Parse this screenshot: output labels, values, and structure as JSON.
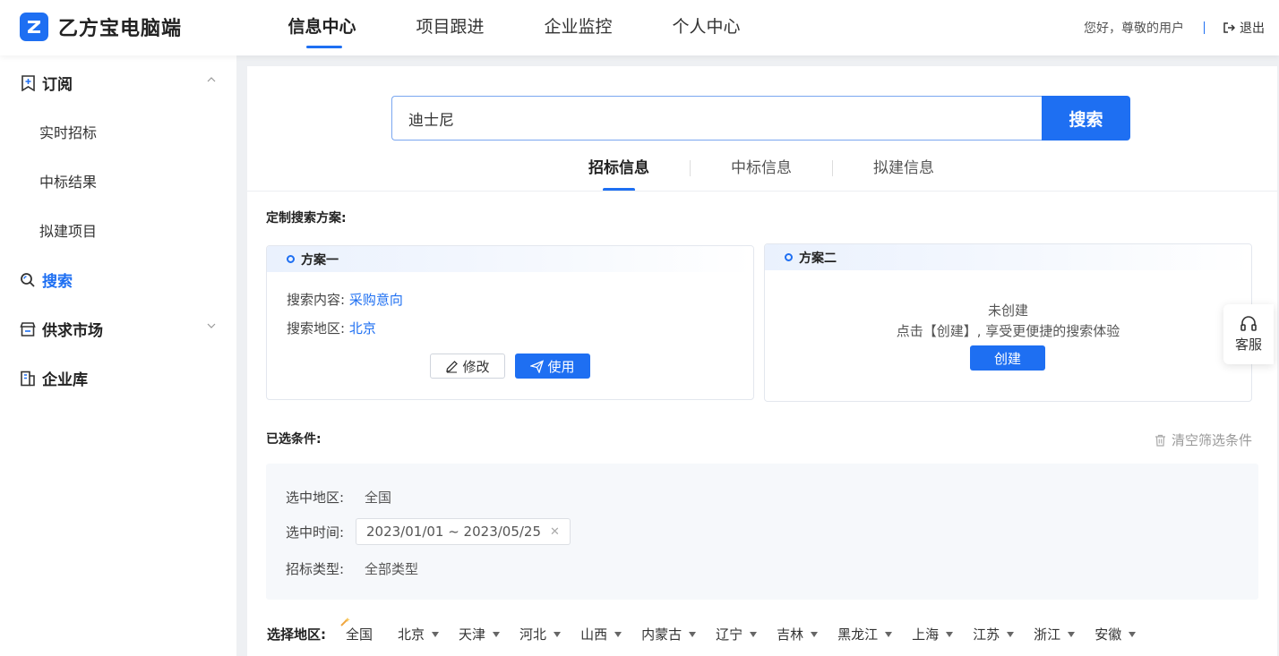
{
  "app": {
    "name": "乙方宝电脑端"
  },
  "nav": {
    "items": [
      "信息中心",
      "项目跟进",
      "企业监控",
      "个人中心"
    ],
    "active": 0
  },
  "user": {
    "greeting": "您好，尊敬的用户",
    "logout": "退出"
  },
  "sidebar": {
    "subscribe": {
      "label": "订阅",
      "items": [
        "实时招标",
        "中标结果",
        "拟建项目"
      ]
    },
    "search": {
      "label": "搜索"
    },
    "market": {
      "label": "供求市场"
    },
    "company": {
      "label": "企业库"
    }
  },
  "search": {
    "value": "迪士尼",
    "button": "搜索"
  },
  "tabs": [
    "招标信息",
    "中标信息",
    "拟建信息"
  ],
  "custom": {
    "title": "定制搜索方案:",
    "plan1": {
      "title": "方案一",
      "content_label": "搜索内容:",
      "content_value": "采购意向",
      "region_label": "搜索地区:",
      "region_value": "北京",
      "edit": "修改",
      "use": "使用"
    },
    "plan2": {
      "title": "方案二",
      "empty": "未创建",
      "hint": "点击【创建】, 享受更便捷的搜索体验",
      "create": "创建"
    }
  },
  "selected": {
    "title": "已选条件:",
    "clear": "清空筛选条件",
    "region_label": "选中地区:",
    "region_value": "全国",
    "time_label": "选中时间:",
    "time_value": "2023/01/01 ~ 2023/05/25",
    "type_label": "招标类型:",
    "type_value": "全部类型"
  },
  "regions": {
    "label": "选择地区:",
    "items": [
      "全国",
      "北京",
      "天津",
      "河北",
      "山西",
      "内蒙古",
      "辽宁",
      "吉林",
      "黑龙江",
      "上海",
      "江苏",
      "浙江",
      "安徽"
    ]
  },
  "service": {
    "label": "客服"
  },
  "colors": {
    "accent": "#1e6ff2"
  }
}
